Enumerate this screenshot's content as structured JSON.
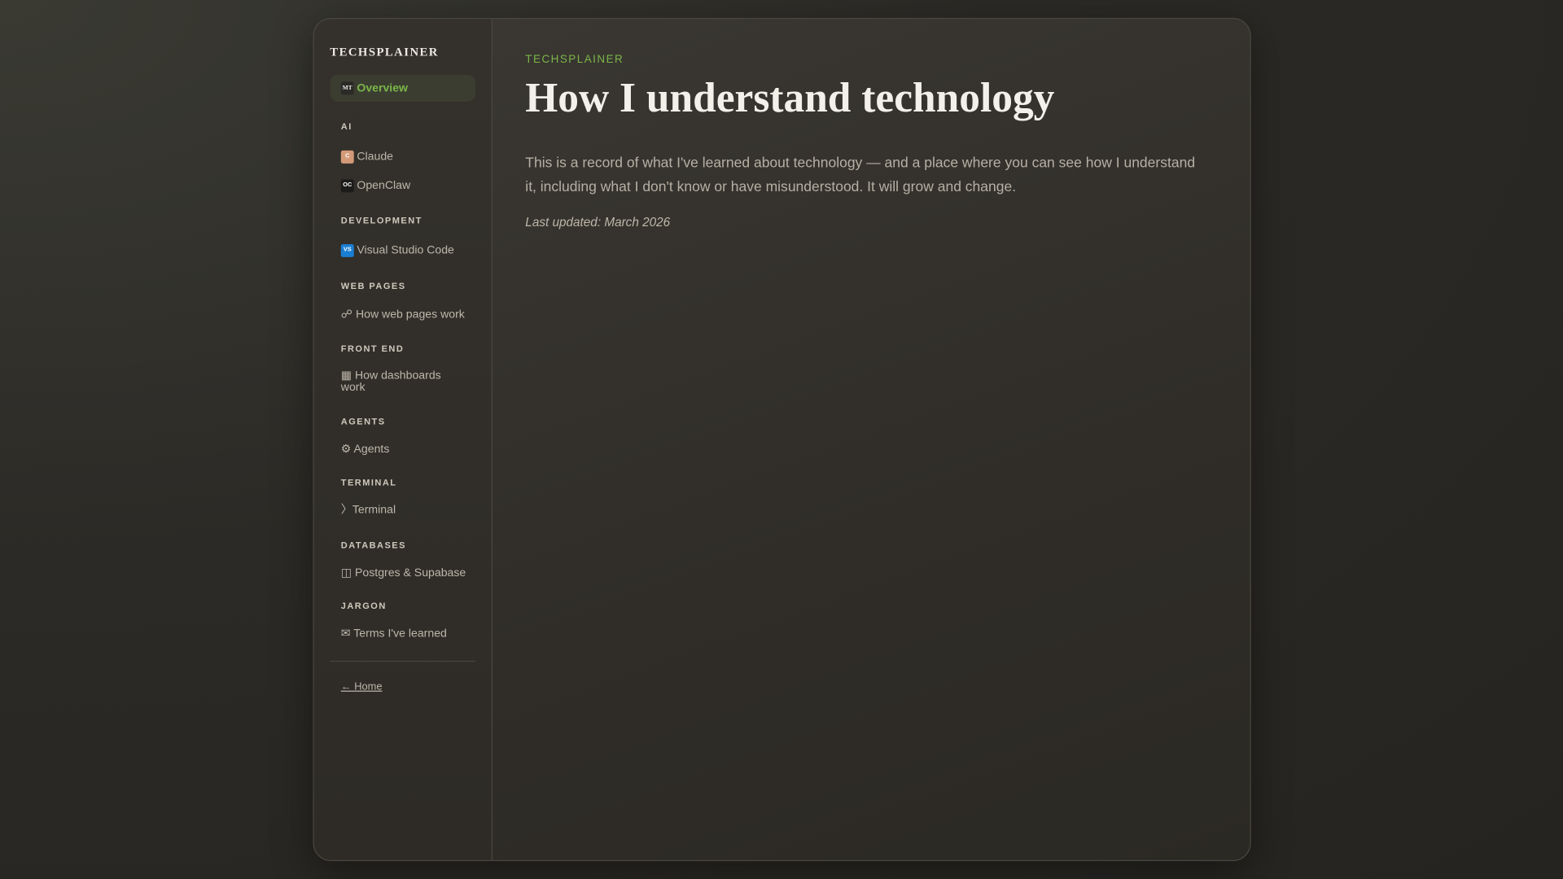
{
  "sidebar": {
    "brand": "TECHSPLAINER",
    "overview": {
      "badge": "MT",
      "label": "Overview"
    },
    "sections": [
      {
        "title": "AI",
        "items": [
          {
            "icon": "C",
            "label": "Claude"
          },
          {
            "icon": "OC",
            "label": "OpenClaw"
          }
        ]
      },
      {
        "title": "DEVELOPMENT",
        "items": [
          {
            "icon": "VS",
            "label": "Visual Studio Code"
          }
        ]
      },
      {
        "title": "WEB PAGES",
        "items": [
          {
            "icon": "☍",
            "label": "How web pages work"
          }
        ]
      },
      {
        "title": "FRONT END",
        "items": [
          {
            "icon": "▦",
            "label": "How dashboards work"
          }
        ]
      },
      {
        "title": "AGENTS",
        "items": [
          {
            "icon": "⚙",
            "label": "Agents"
          }
        ]
      },
      {
        "title": "TERMINAL",
        "items": [
          {
            "icon": "〉",
            "label": "Terminal"
          }
        ]
      },
      {
        "title": "DATABASES",
        "items": [
          {
            "icon": "◫",
            "label": "Postgres & Supabase"
          }
        ]
      },
      {
        "title": "JARGON",
        "items": [
          {
            "icon": "✉",
            "label": "Terms I've learned"
          }
        ]
      }
    ],
    "home_link": "← Home"
  },
  "main": {
    "kicker": "TECHSPLAINER",
    "title": "How I understand technology",
    "intro": "This is a record of what I've learned about technology — and a place where you can see how I understand it, including what I don't know or have misunderstood. It will grow and change.",
    "updated": "Last updated: March 2026"
  },
  "colors": {
    "accent": "#7ab648",
    "claude": "#d49a78",
    "vscode": "#1a7fd4",
    "openclaw": "#1c1b19"
  }
}
